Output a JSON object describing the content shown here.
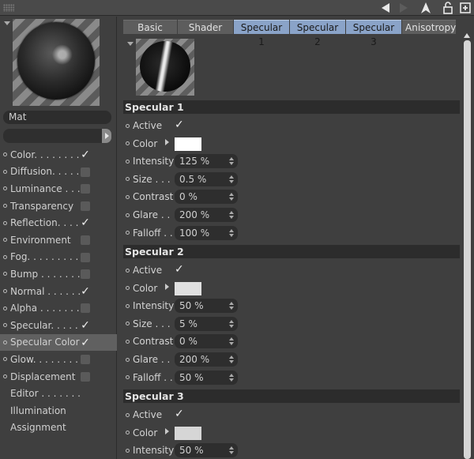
{
  "toolbar": {
    "icons": [
      "back-arrow-icon",
      "forward-arrow-icon",
      "cursor-up-icon",
      "lock-icon",
      "add-window-icon"
    ]
  },
  "material": {
    "name": "Mat",
    "link_field": ""
  },
  "channels": [
    {
      "label": "Color. . . . . . . .",
      "dot": true,
      "checked": true,
      "selected": false
    },
    {
      "label": "Diffusion. . . . .",
      "dot": true,
      "checked": false,
      "selected": false
    },
    {
      "label": "Luminance . . .",
      "dot": true,
      "checked": false,
      "selected": false
    },
    {
      "label": "Transparency",
      "dot": true,
      "checked": false,
      "selected": false
    },
    {
      "label": "Reflection. . . .",
      "dot": true,
      "checked": true,
      "selected": false
    },
    {
      "label": "Environment",
      "dot": true,
      "checked": false,
      "selected": false
    },
    {
      "label": "Fog. . . . . . . . .",
      "dot": true,
      "checked": false,
      "selected": false
    },
    {
      "label": "Bump . . . . . . .",
      "dot": true,
      "checked": false,
      "selected": false
    },
    {
      "label": "Normal . . . . . .",
      "dot": true,
      "checked": true,
      "selected": false
    },
    {
      "label": "Alpha . . . . . . .",
      "dot": true,
      "checked": false,
      "selected": false
    },
    {
      "label": "Specular. . . . .",
      "dot": true,
      "checked": true,
      "selected": false
    },
    {
      "label": "Specular Color",
      "dot": true,
      "checked": true,
      "selected": true
    },
    {
      "label": "Glow. . . . . . . .",
      "dot": true,
      "checked": false,
      "selected": false
    },
    {
      "label": "Displacement",
      "dot": true,
      "checked": false,
      "selected": false
    },
    {
      "label": "Editor . . . . . . .",
      "dot": false,
      "checked": null,
      "selected": false
    },
    {
      "label": "Illumination",
      "dot": false,
      "checked": null,
      "selected": false
    },
    {
      "label": "Assignment",
      "dot": false,
      "checked": null,
      "selected": false
    }
  ],
  "tabs": [
    {
      "label": "Basic",
      "active": false
    },
    {
      "label": "Shader",
      "active": false
    },
    {
      "label": "Specular 1",
      "active": true
    },
    {
      "label": "Specular 2",
      "active": true
    },
    {
      "label": "Specular 3",
      "active": true
    },
    {
      "label": "Anisotropy",
      "active": false
    }
  ],
  "sections": [
    {
      "title": "Specular 1",
      "active_label": "Active",
      "active": true,
      "color_label": "Color",
      "color": "#ffffff",
      "intensity_label": "Intensity",
      "intensity": "125 %",
      "size_label": "Size . . .",
      "size": "0.5 %",
      "contrast_label": "Contrast",
      "contrast": "0 %",
      "glare_label": "Glare . .",
      "glare": "200 %",
      "falloff_label": "Falloff . .",
      "falloff": "100 %"
    },
    {
      "title": "Specular 2",
      "active_label": "Active",
      "active": true,
      "color_label": "Color",
      "color": "#e0e0e0",
      "intensity_label": "Intensity",
      "intensity": "50 %",
      "size_label": "Size . . .",
      "size": "5 %",
      "contrast_label": "Contrast",
      "contrast": "0 %",
      "glare_label": "Glare . .",
      "glare": "200 %",
      "falloff_label": "Falloff . .",
      "falloff": "50 %"
    },
    {
      "title": "Specular 3",
      "active_label": "Active",
      "active": true,
      "color_label": "Color",
      "color": "#d6d6d6",
      "intensity_label": "Intensity",
      "intensity": "50 %"
    }
  ],
  "check_glyph": "✓"
}
